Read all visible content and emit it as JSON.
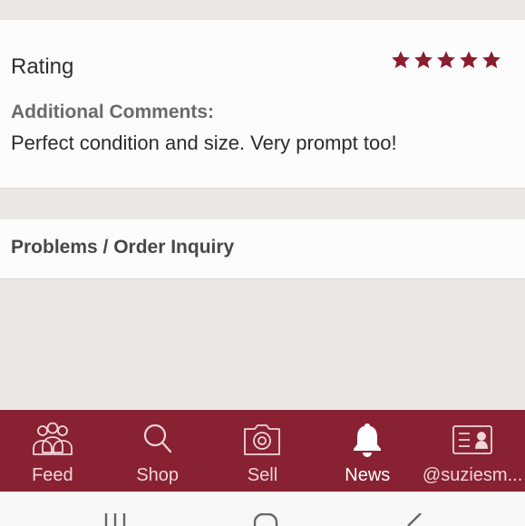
{
  "rating_card": {
    "label": "Rating",
    "stars_filled": 5,
    "stars_total": 5,
    "comments_heading": "Additional Comments:",
    "comments_text": "Perfect condition and size. Very prompt too!"
  },
  "problems_card": {
    "label": "Problems / Order Inquiry"
  },
  "tabbar": {
    "active": "news",
    "items": [
      {
        "id": "feed",
        "label": "Feed",
        "icon": "people-icon"
      },
      {
        "id": "shop",
        "label": "Shop",
        "icon": "search-icon"
      },
      {
        "id": "sell",
        "label": "Sell",
        "icon": "camera-icon"
      },
      {
        "id": "news",
        "label": "News",
        "icon": "bell-icon"
      },
      {
        "id": "profile",
        "label": "@suziesm...",
        "icon": "id-card-icon"
      }
    ]
  },
  "colors": {
    "brand": "#882232",
    "star": "#8b1e2e",
    "background": "#ebe8e3",
    "card": "#fcfcfc"
  },
  "system_nav": {
    "buttons": [
      "recent-apps-icon",
      "home-icon",
      "back-icon"
    ]
  }
}
